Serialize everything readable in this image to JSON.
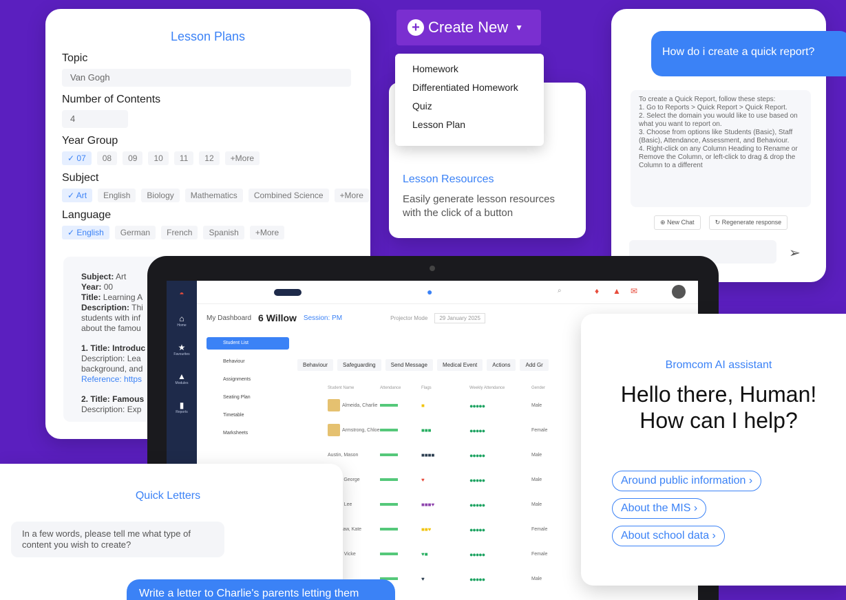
{
  "lesson_plans": {
    "title": "Lesson Plans",
    "topic_label": "Topic",
    "topic_value": "Van Gogh",
    "contents_label": "Number of Contents",
    "contents_value": "4",
    "year_label": "Year Group",
    "year_chips": [
      "✓ 07",
      "08",
      "09",
      "10",
      "11",
      "12",
      "+More"
    ],
    "subject_label": "Subject",
    "subject_chips": [
      "✓ Art",
      "English",
      "Biology",
      "Mathematics",
      "Combined Science",
      "+More"
    ],
    "language_label": "Language",
    "language_chips": [
      "✓ English",
      "German",
      "French",
      "Spanish",
      "+More"
    ],
    "output": {
      "subject_k": "Subject:",
      "subject_v": " Art",
      "year_k": "Year:",
      "year_v": " 00",
      "title_k": "Title:",
      "title_v": " Learning A",
      "desc_k": "Description:",
      "desc_v": " Thi",
      "line1": "students with inf",
      "line2": "about the famou",
      "item1_title": "1. Title: Introduc",
      "item1_l1": "Description: Lea",
      "item1_l2": "background, and",
      "item1_l3": "Reference: https",
      "item2_title": "2. Title: Famous",
      "item2_l1": "Description: Exp"
    }
  },
  "create_new": {
    "label": "Create New",
    "menu": [
      "Homework",
      "Differentiated Homework",
      "Quiz",
      "Lesson Plan"
    ]
  },
  "resources": {
    "title": "Lesson Resources",
    "description": "Easily generate lesson resources with the click of a button"
  },
  "chat": {
    "question": "How do i create a quick report?",
    "answer": [
      "To create a Quick Report, follow these steps:",
      "1. Go to Reports > Quick Report > Quick Report.",
      "2. Select the domain you would like to use based on what you want to report on.",
      "3. Choose from options like Students (Basic), Staff (Basic), Attendance, Assessment, and Behaviour.",
      "4. Right-click on any Column Heading to Rename or Remove the Column, or left-click to drag & drop the Column to a different"
    ],
    "new_chat": "New Chat",
    "regenerate": "Regenerate response"
  },
  "mis": {
    "breadcrumb_dashboard": "My Dashboard",
    "class_name": "6 Willow",
    "session": "Session: PM",
    "projector_mode": "Projector Mode",
    "date": "29 January 2025",
    "sidebar": [
      {
        "icon": "home",
        "label": "Home"
      },
      {
        "icon": "star",
        "label": "Favourites"
      },
      {
        "icon": "modules",
        "label": "Modules"
      },
      {
        "icon": "reports",
        "label": "Reports"
      }
    ],
    "nav": [
      "Student List",
      "Behaviour",
      "Assignments",
      "Seating Plan",
      "Timetable",
      "Marksheets"
    ],
    "actions": [
      "Behaviour",
      "Safeguarding",
      "Send Message",
      "Medical Event",
      "Actions",
      "Add Gr"
    ],
    "columns": [
      "Student Name",
      "Attendance",
      "Flags",
      "Weekly Attendance",
      "Gender"
    ],
    "rows": [
      {
        "name": "Almeida, Charlie",
        "flags": "■",
        "gender": "Male"
      },
      {
        "name": "Armstrong, Chloe",
        "flags": "■■■",
        "gender": "Female"
      },
      {
        "name": "Austin, Mason",
        "flags": "■■■■",
        "gender": "Male"
      },
      {
        "name": "Banks, George",
        "flags": "♥",
        "gender": "Male"
      },
      {
        "name": "Baxter, Lee",
        "flags": "■■■♥",
        "gender": "Male"
      },
      {
        "name": "Bradshaw, Kate",
        "flags": "■■♥",
        "gender": "Female"
      },
      {
        "name": "Brown, Vicke",
        "flags": "♥■",
        "gender": "Female"
      },
      {
        "name": "",
        "flags": "♥",
        "gender": "Male"
      }
    ],
    "weekly_dots": "●●●●●"
  },
  "ai": {
    "title": "Bromcom AI assistant",
    "heading_l1": "Hello there, Human!",
    "heading_l2": "How can I help?",
    "options": [
      "Around public information",
      "About the MIS",
      "About school data"
    ]
  },
  "quick_letters": {
    "title": "Quick Letters",
    "prompt": "In a few words, please tell me what type of content you wish to create?",
    "message": "Write a letter to Charlie's parents letting them"
  }
}
